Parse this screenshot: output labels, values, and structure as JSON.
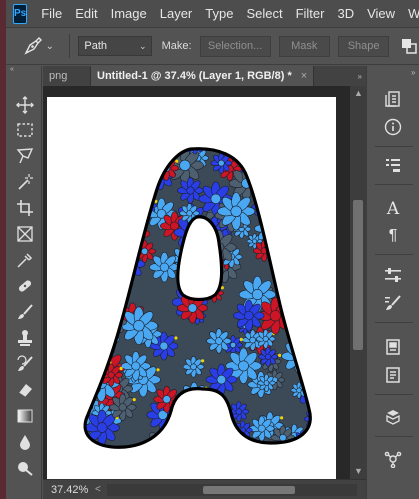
{
  "app": {
    "logo": "Ps"
  },
  "menu": [
    "File",
    "Edit",
    "Image",
    "Layer",
    "Type",
    "Select",
    "Filter",
    "3D",
    "View",
    "Wi"
  ],
  "options": {
    "tool_icon": "pen-tool-icon",
    "mode_value": "Path",
    "make_label": "Make:",
    "selection_label": "Selection...",
    "mask_label": "Mask",
    "shape_label": "Shape"
  },
  "tabs": [
    {
      "label": "png"
    },
    {
      "label": "Untitled-1 @ 37.4% (Layer 1, RGB/8) *",
      "close": "×",
      "active": true
    }
  ],
  "status": {
    "zoom": "37.42%"
  },
  "colors": {
    "flower_red": "#cc1626",
    "flower_blue": "#2a3ee6",
    "flower_sky": "#4aa8f2",
    "flower_slate": "#4e6070",
    "flower_center": "#f2d400"
  },
  "left_tools": [
    "move-icon",
    "marquee-icon",
    "lasso-icon",
    "magic-wand-icon",
    "crop-icon",
    "frame-icon",
    "eyedropper-icon",
    "healing-brush-icon",
    "brush-icon",
    "clone-stamp-icon",
    "history-brush-icon",
    "eraser-icon",
    "gradient-icon",
    "blur-icon",
    "dodge-icon"
  ],
  "right_tools": [
    "history-icon",
    "info-icon",
    "properties-icon",
    "character-icon",
    "paragraph-icon",
    "adjustments-icon",
    "brush-settings-icon",
    "swatches-icon",
    "libraries-icon",
    "layers-3d-icon",
    "channels-icon"
  ]
}
